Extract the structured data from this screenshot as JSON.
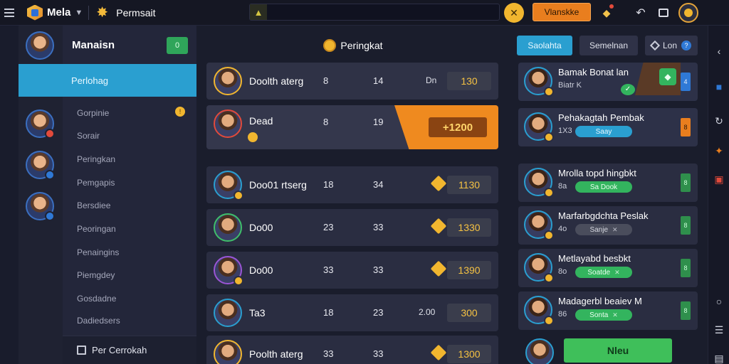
{
  "topbar": {
    "app_title": "Mela",
    "section_title": "Permsait",
    "search_placeholder": "",
    "primary_button": "Vlanskke"
  },
  "nav": {
    "title": "Manaisn",
    "badge": "0",
    "active_item": "Perlohag",
    "items": [
      "Gorpinie",
      "Sorair",
      "Peringkan",
      "Pemgapis",
      "Bersdiee",
      "Peoringan",
      "Penaingins",
      "Piemgdey",
      "Gosdadne",
      "Dadiedsers"
    ],
    "item_dot": "!",
    "footer_label": "Per Cerrokah"
  },
  "main": {
    "title": "Peringkat",
    "rows": [
      {
        "name": "Doolth aterg",
        "c1": "8",
        "c2": "14",
        "c3": "Dn",
        "score": "130"
      },
      {
        "name": "Dead",
        "c1": "8",
        "c2": "19",
        "c3": "",
        "score": "+1200"
      },
      {
        "name": "Doo01 rtserg",
        "c1": "18",
        "c2": "34",
        "c3": "",
        "score": "1130"
      },
      {
        "name": "Do00",
        "c1": "23",
        "c2": "33",
        "c3": "",
        "score": "1330"
      },
      {
        "name": "Do00",
        "c1": "33",
        "c2": "33",
        "c3": "",
        "score": "1390"
      },
      {
        "name": "Ta3",
        "c1": "18",
        "c2": "23",
        "c3": "2.00",
        "score": "300"
      },
      {
        "name": "Poolth aterg",
        "c1": "33",
        "c2": "33",
        "c3": "",
        "score": "1300"
      }
    ]
  },
  "right": {
    "tabs": [
      "Saolahta",
      "Semelnan",
      "Lon"
    ],
    "cards": [
      {
        "title": "Bamak Bonat lan",
        "sub": "Biatr K",
        "pill": "",
        "side": "4"
      },
      {
        "title": "Pehakagtah Pembak",
        "sub": "1X3",
        "pill": "Saay",
        "side": "8"
      },
      {
        "title": "Mrolla topd hingbkt",
        "sub": "8a",
        "pill": "Sa Dook",
        "side": "8"
      },
      {
        "title": "Marfarbgdchta Peslak",
        "sub": "4o",
        "pill": "Sanje",
        "side": "8"
      },
      {
        "title": "Metlayabd besbkt",
        "sub": "8o",
        "pill": "Soatde",
        "side": "8"
      },
      {
        "title": "Madagerbl beaiev M",
        "sub": "86",
        "pill": "Sonta",
        "side": "8"
      }
    ],
    "new_button": "Nleu"
  },
  "colors": {
    "accent": "#2a9fd0",
    "orange": "#ef8a1f",
    "gold": "#f1b62f",
    "green": "#3fbf5a"
  }
}
